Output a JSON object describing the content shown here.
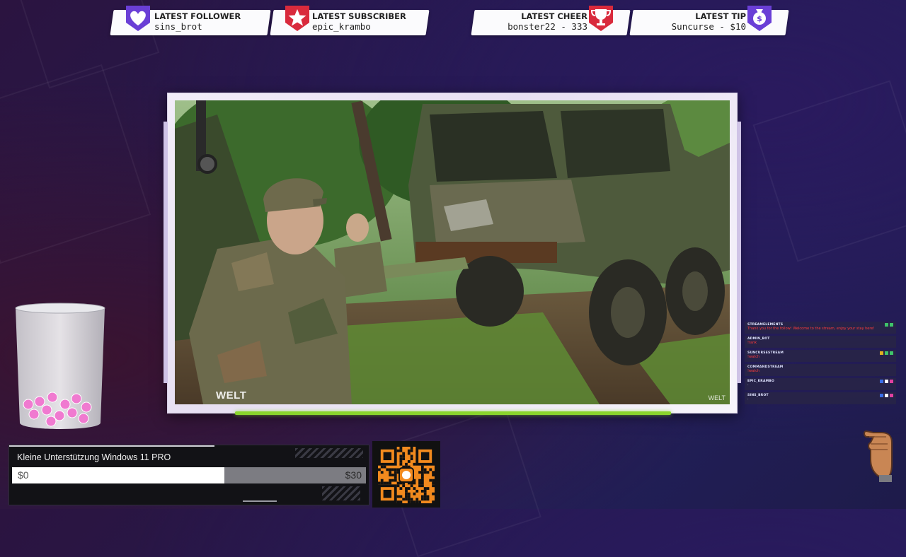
{
  "alerts": {
    "follower": {
      "title": "LATEST FOLLOWER",
      "value": "sins_brot",
      "icon": "heart-icon",
      "color": "#6a3fd6"
    },
    "subscriber": {
      "title": "LATEST SUBSCRIBER",
      "value": "epic_krambo",
      "icon": "star-icon",
      "color": "#d92a3c"
    },
    "cheer": {
      "title": "LATEST CHEER",
      "value": "bonster22 - 333",
      "icon": "trophy-icon",
      "color": "#d92a3c"
    },
    "tip": {
      "title": "LATEST TIP",
      "value": "Suncurse - $10",
      "icon": "money-bag-icon",
      "color": "#6a3fd6"
    }
  },
  "video": {
    "watermark": "WELT",
    "watermark_corner": "WELT",
    "accent_bar_color": "#8ad52d"
  },
  "goal": {
    "label": "Kleine Unterstützung Windows 11 PRO",
    "min": "$0",
    "max": "$30",
    "progress": 0.6
  },
  "chat": {
    "messages": [
      {
        "user": "STREAMELEMENTS",
        "color": "#ff3b3b",
        "text": "Thank you for the follow! Welcome to the stream, enjoy your stay here!",
        "icons": [
          "#3fc46a",
          "#3fc46a"
        ]
      },
      {
        "user": "ADMIN_BOT",
        "color": "#ff3b3b",
        "text": "!rank",
        "icons": []
      },
      {
        "user": "SUNCURSESTREAM",
        "color": "#ff3b3b",
        "text": "!watch",
        "icons": [
          "#e0b020",
          "#3fc46a",
          "#3fc46a"
        ]
      },
      {
        "user": "COMMANDSTREAM",
        "color": "#ff3b3b",
        "text": "!watch",
        "icons": []
      },
      {
        "user": "EPIC_KRAMBO",
        "color": "#d8d8e8",
        "text": "·",
        "icons": [
          "#3a6ee8",
          "#ffffff",
          "#e040a0"
        ]
      },
      {
        "user": "SINS_BROT",
        "color": "#d8d8e8",
        "text": "·",
        "icons": [
          "#3a6ee8",
          "#ffffff",
          "#e040a0"
        ]
      }
    ]
  }
}
